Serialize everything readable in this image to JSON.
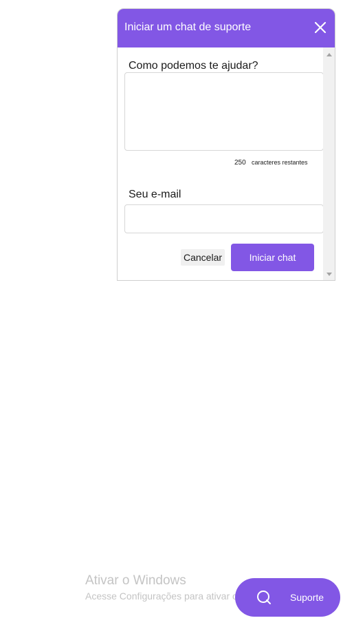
{
  "chat": {
    "title": "Iniciar um chat de suporte",
    "help_label": "Como podemos te ajudar?",
    "help_value": "",
    "char_count": "250",
    "char_count_label": "caracteres restantes",
    "email_label": "Seu e-mail",
    "email_value": "",
    "cancel_label": "Cancelar",
    "start_label": "Iniciar chat",
    "close_icon": "close-icon"
  },
  "watermark": {
    "title": "Ativar o Windows",
    "subtitle": "Acesse Configurações para ativar o Windows."
  },
  "support": {
    "label": "Suporte",
    "icon": "chat-bubble-icon"
  },
  "colors": {
    "accent": "#8257e5",
    "header_text": "#ffffff",
    "watermark": "#c4c4c4"
  }
}
